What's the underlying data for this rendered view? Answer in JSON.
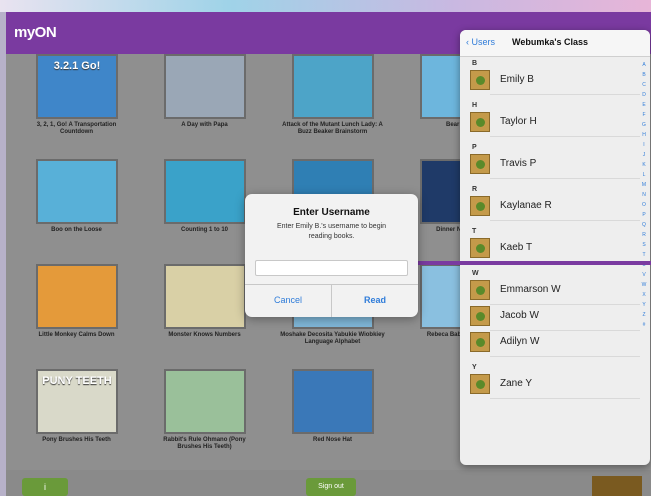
{
  "app": {
    "logo": "myON"
  },
  "books": [
    {
      "title": "3, 2, 1, Go! A Transportation Countdown",
      "cover_label": "3.2.1 Go!",
      "cover_color": "#3f86c9"
    },
    {
      "title": "A Day with Papa",
      "cover_label": "",
      "cover_color": "#9aa7b6"
    },
    {
      "title": "Attack of the Mutant Lunch Lady: A Buzz Beaker Brainstorm",
      "cover_label": "",
      "cover_color": "#4da4c8"
    },
    {
      "title": "Bear Says",
      "cover_label": "",
      "cover_color": "#6db6dd"
    },
    {
      "title": "Boo on the Loose",
      "cover_label": "",
      "cover_color": "#58b0d8"
    },
    {
      "title": "Counting 1 to 10",
      "cover_label": "",
      "cover_color": "#3aa2c9"
    },
    {
      "title": "",
      "cover_label": "",
      "cover_color": "#2f7fb4"
    },
    {
      "title": "Dinner Nex Night",
      "cover_label": "",
      "cover_color": "#1f3a68"
    },
    {
      "title": "Little Monkey Calms Down",
      "cover_label": "",
      "cover_color": "#e49a3a"
    },
    {
      "title": "Monster Knows Numbers",
      "cover_label": "",
      "cover_color": "#d9d0a6"
    },
    {
      "title": "Moshake Decosita Yabukie Wiobkiey Language Alphabet",
      "cover_label": "",
      "cover_color": "#7fb7d8"
    },
    {
      "title": "Rebeca Baby Blue Bear",
      "cover_label": "",
      "cover_color": "#8ac0e0"
    },
    {
      "title": "Pony Brushes His Teeth",
      "cover_label": "PUNY TEETH",
      "cover_color": "#d9d9c9"
    },
    {
      "title": "Rabbit's Rule Ohmano (Pony Brushes His Teeth)",
      "cover_label": "",
      "cover_color": "#9ac09a"
    },
    {
      "title": "Red Nose Hat",
      "cover_label": "",
      "cover_color": "#3a78b8"
    }
  ],
  "buttons": {
    "info": "i",
    "signout": "Sign out"
  },
  "popover": {
    "back_label": "Users",
    "title": "Webumka's Class",
    "sections": [
      {
        "letter": "B",
        "students": [
          "Emily B"
        ]
      },
      {
        "letter": "H",
        "students": [
          "Taylor H"
        ]
      },
      {
        "letter": "P",
        "students": [
          "Travis P"
        ]
      },
      {
        "letter": "R",
        "students": [
          "Kaylanae R"
        ]
      },
      {
        "letter": "T",
        "students": [
          "Kaeb T"
        ]
      },
      {
        "letter": "W",
        "students": [
          "Emmarson W",
          "Jacob W",
          "Adilyn W"
        ]
      },
      {
        "letter": "Y",
        "students": [
          "Zane Y"
        ]
      }
    ],
    "index_letters": "A B C D E F G H I J K L M N O P Q R S T U V W X Y Z #"
  },
  "dialog": {
    "title": "Enter Username",
    "message": "Enter Emily B.'s username to begin reading books.",
    "input_value": "",
    "cancel_label": "Cancel",
    "read_label": "Read"
  }
}
